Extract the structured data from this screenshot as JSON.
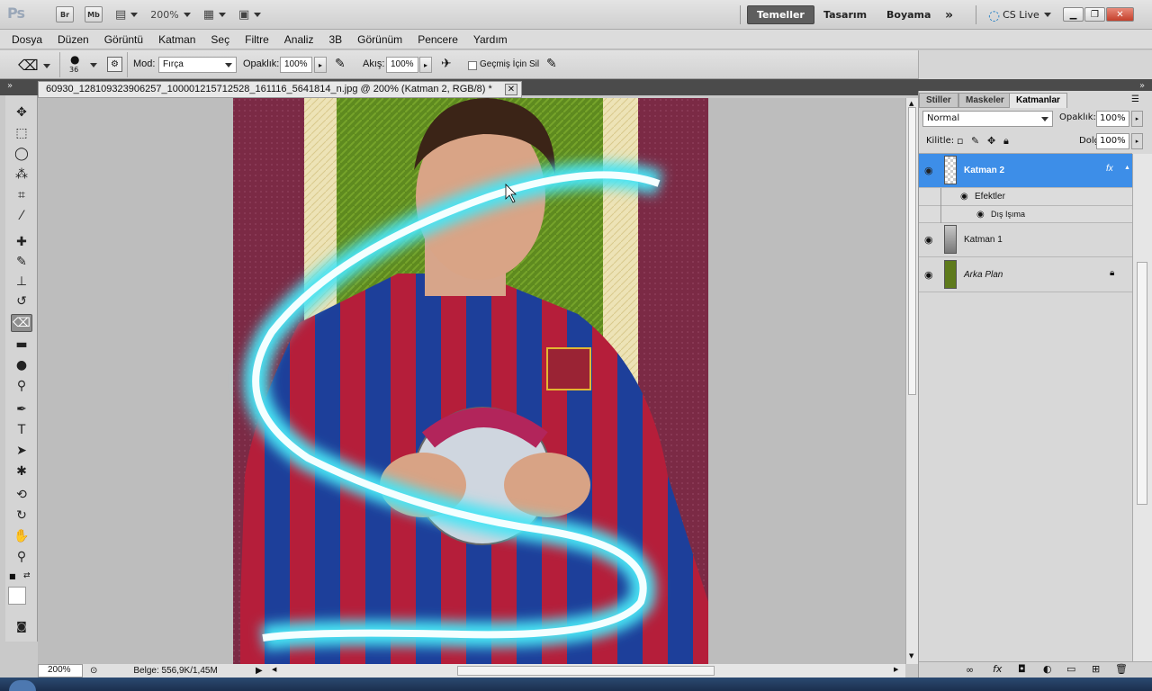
{
  "app": {
    "logo": "Ps",
    "bridge": "Br",
    "minibridge": "Mb",
    "zoom": "200%",
    "workspaces": [
      "Temeller",
      "Tasarım",
      "Boyama"
    ],
    "more": "»",
    "cslive": "CS Live"
  },
  "menu": [
    "Dosya",
    "Düzen",
    "Görüntü",
    "Katman",
    "Seç",
    "Filtre",
    "Analiz",
    "3B",
    "Görünüm",
    "Pencere",
    "Yardım"
  ],
  "options": {
    "brush_size": "36",
    "mode_label": "Mod:",
    "mode_value": "Fırça",
    "opacity_label": "Opaklık:",
    "opacity_value": "100%",
    "flow_label": "Akış:",
    "flow_value": "100%",
    "history_label": "Geçmiş İçin Sil"
  },
  "document": {
    "tab_title": "60930_128109323906257_100001215712528_161116_5641814_n.jpg @ 200% (Katman 2, RGB/8) *"
  },
  "status": {
    "zoom": "200%",
    "doc_size": "Belge: 556,9K/1,45M"
  },
  "panel": {
    "tabs": [
      "Stiller",
      "Maskeler",
      "Katmanlar"
    ],
    "blend_mode": "Normal",
    "opacity_label": "Opaklık:",
    "opacity_value": "100%",
    "lock_label": "Kilitle:",
    "fill_label": "Dolgu:",
    "fill_value": "100%",
    "layers": [
      {
        "name": "Katman 2",
        "selected": true,
        "fx": "fx"
      },
      {
        "name": "Efektler",
        "sub": true
      },
      {
        "name": "Dış Işıma",
        "sub": true
      },
      {
        "name": "Katman 1"
      },
      {
        "name": "Arka Plan",
        "locked": true
      }
    ]
  }
}
